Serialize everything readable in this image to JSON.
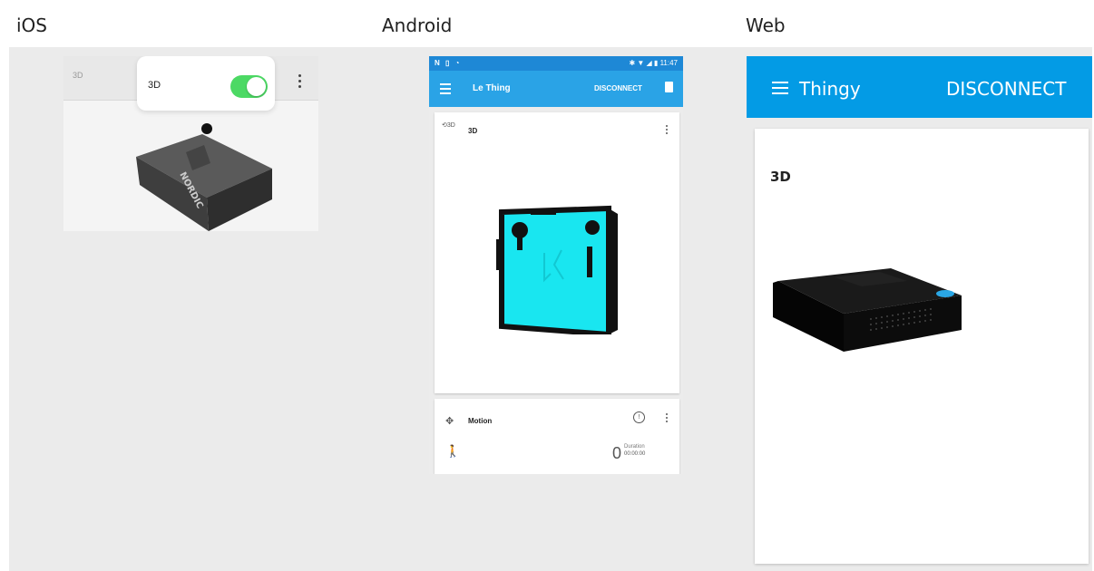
{
  "columns": {
    "ios": "iOS",
    "android": "Android",
    "web": "Web"
  },
  "ios": {
    "bar_label": "3D",
    "popover_label": "3D",
    "toggle_on": true,
    "device_brand": "NORDIC"
  },
  "android": {
    "status_right": "11:47",
    "app_title": "Le Thing",
    "disconnect_label": "DISCONNECT",
    "card_3d_title": "3D",
    "card_3d_icon": "3D",
    "motion_title": "Motion",
    "motion_count": "0",
    "duration_label": "Duration",
    "duration_value": "00:00:00"
  },
  "web": {
    "app_title": "Thingy",
    "disconnect_label": "DISCONNECT",
    "card_title": "3D"
  },
  "colors": {
    "android_status": "#1e88d6",
    "android_appbar": "#2aa3e6",
    "web_appbar": "#039be5",
    "ios_toggle": "#4cd964",
    "android_device": "#19e6f0"
  },
  "icons": [
    "menu-icon",
    "kebab-icon",
    "trash-icon",
    "motion-icon",
    "info-icon",
    "walk-icon",
    "rotate-3d-icon"
  ]
}
